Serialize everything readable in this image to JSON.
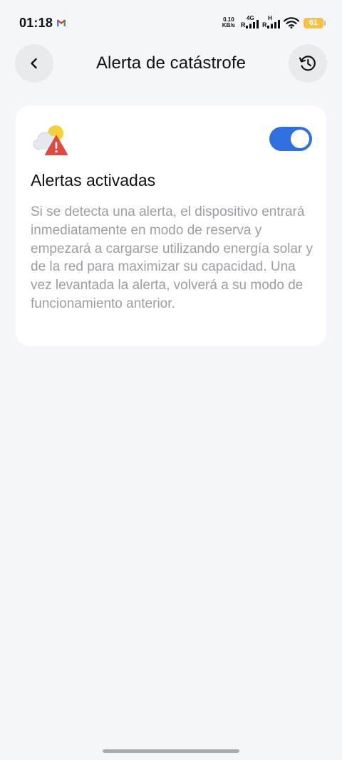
{
  "status_bar": {
    "time": "01:18",
    "notification_icon": "gmail-icon",
    "net_speed_value": "0.10",
    "net_speed_unit": "KB/s",
    "sim1_type": "4G",
    "sim1_roaming": "R",
    "sim2_type": "H",
    "sim2_roaming": "R",
    "battery_level": "61",
    "battery_color": "#f5c242"
  },
  "header": {
    "title": "Alerta de catástrofe",
    "back_icon": "chevron-left-icon",
    "history_icon": "history-icon"
  },
  "card": {
    "icon": "weather-alert-icon",
    "title": "Alertas activadas",
    "toggle_on": true,
    "toggle_color": "#2f6fe0",
    "description": "Si se detecta una alerta, el dispositivo entrará inmediatamente en modo de reserva y empezará a cargarse utilizando energía solar y de la red para maximizar su capacidad. Una vez levantada la alerta, volverá a su modo de funcionamiento anterior."
  }
}
